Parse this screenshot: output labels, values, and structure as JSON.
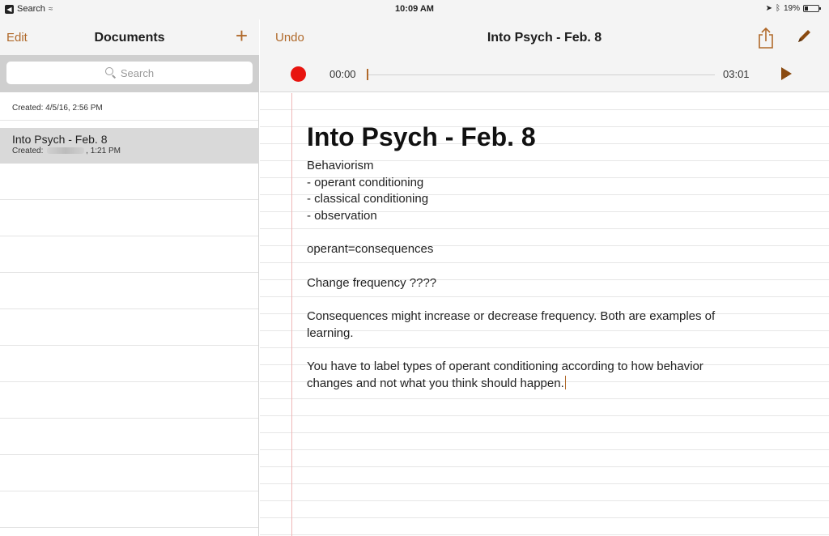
{
  "status_bar": {
    "back_label": "Search",
    "time": "10:09 AM",
    "battery": "19%"
  },
  "sidebar": {
    "edit_label": "Edit",
    "title": "Documents",
    "add_label": "+",
    "search_placeholder": "Search",
    "documents": [
      {
        "title": "",
        "created": "Created: 4/5/16, 2:56 PM"
      },
      {
        "title": "Into Psych - Feb. 8",
        "created_prefix": "Created:",
        "created_time": ", 1:21 PM",
        "selected": true
      }
    ]
  },
  "main": {
    "undo_label": "Undo",
    "title": "Into Psych - Feb. 8",
    "player": {
      "time_current": "00:00",
      "time_total": "03:01",
      "progress": 0.0
    },
    "note": {
      "heading": "Into Psych - Feb. 8",
      "lines": [
        "Behaviorism",
        "- operant conditioning",
        "- classical conditioning",
        "- observation",
        "",
        "operant=consequences",
        "",
        "Change frequency ????",
        "",
        "Consequences might increase or decrease frequency. Both are examples of",
        "learning.",
        "",
        "You have to label types of operant conditioning according to how behavior",
        "changes and not what you think should happen."
      ]
    }
  },
  "colors": {
    "accent": "#b0692a",
    "record": "#e8140f",
    "selected_row": "#d9d9d9"
  }
}
